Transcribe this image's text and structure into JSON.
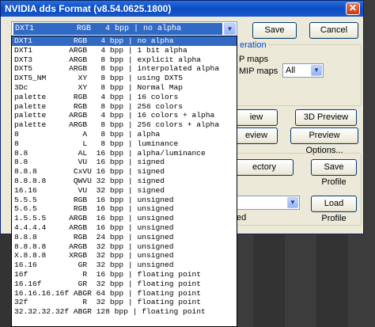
{
  "window": {
    "title": "NVIDIA dds Format (v8.54.0625.1800)",
    "close_glyph": "✕"
  },
  "format_combo": {
    "value": "DXT1         RGB   4 bpp | no alpha",
    "arrow": "▼"
  },
  "buttons": {
    "save": "Save",
    "cancel": "Cancel",
    "preview_2d": "iew",
    "preview_3d": "3D Preview",
    "review": "eview",
    "preview_options": "Preview Options...",
    "directory": "ectory",
    "save_profile": "Save Profile",
    "load_profile": "Load Profile"
  },
  "partial_labels": {
    "generation": "eration",
    "mip_maps": "P maps",
    "mip_maps2": "MIP maps",
    "ed": "ed"
  },
  "mip_combo": {
    "value": "All",
    "arrow": "▼"
  },
  "profile_combo": {
    "arrow": "▼"
  },
  "format_list": [
    "DXT1         RGB   4 bpp | no alpha",
    "DXT1        ARGB   4 bpp | 1 bit alpha",
    "DXT3        ARGB   8 bpp | explicit alpha",
    "DXT5        ARGB   8 bpp | interpolated alpha",
    "DXT5_NM       XY   8 bpp | using DXT5",
    "3Dc           XY   8 bpp | Normal Map",
    "palette      RGB   4 bpp | 16 colors",
    "palette      RGB   8 bpp | 256 colors",
    "palette     ARGB   4 bpp | 16 colors + alpha",
    "palette     ARGB   8 bpp | 256 colors + alpha",
    "8              A   8 bpp | alpha",
    "8              L   8 bpp | luminance",
    "8.8           AL  16 bpp | alpha/luminance",
    "8.8           VU  16 bpp | signed",
    "8.8.8        CxVU 16 bpp | signed",
    "8.8.8.8      QWVU 32 bpp | signed",
    "16.16         VU  32 bpp | signed",
    "5.5.5        RGB  16 bpp | unsigned",
    "5.6.5        RGB  16 bpp | unsigned",
    "1.5.5.5     ARGB  16 bpp | unsigned",
    "4.4.4.4     ARGB  16 bpp | unsigned",
    "8.8.8        RGB  24 bpp | unsigned",
    "8.8.8.8     ARGB  32 bpp | unsigned",
    "X.8.8.8     XRGB  32 bpp | unsigned",
    "16.16         GR  32 bpp | unsigned",
    "16f            R  16 bpp | floating point",
    "16.16f        GR  32 bpp | floating point",
    "16.16.16.16f ABGR 64 bpp | floating point",
    "32f            R  32 bpp | floating point",
    "32.32.32.32f ABGR 128 bpp | floating point"
  ],
  "selected_index": 0
}
